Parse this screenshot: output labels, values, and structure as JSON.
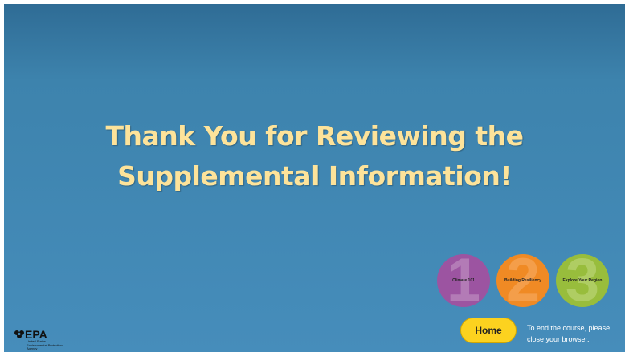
{
  "title": {
    "line1": "Thank You for Reviewing the",
    "line2": "Supplemental Information!"
  },
  "modules": [
    {
      "number": "1",
      "label": "Climate 101",
      "color": "#9c54a1",
      "num_color": "#c69bc9"
    },
    {
      "number": "2",
      "label": "Building Resiliency",
      "color": "#f08a24",
      "num_color": "#f8b06a"
    },
    {
      "number": "3",
      "label": "Explore Your Region",
      "color": "#98bd3c",
      "num_color": "#c4da84"
    }
  ],
  "home_button": {
    "label": "Home"
  },
  "end_note": {
    "line1": "To end the course, please",
    "line2": "close your browser."
  },
  "logo": {
    "wordmark": "EPA",
    "sub1": "United States",
    "sub2": "Environmental Protection",
    "sub3": "Agency"
  },
  "colors": {
    "background": "#3f86b3",
    "title": "#fde39a",
    "home_button": "#fcd21f"
  }
}
